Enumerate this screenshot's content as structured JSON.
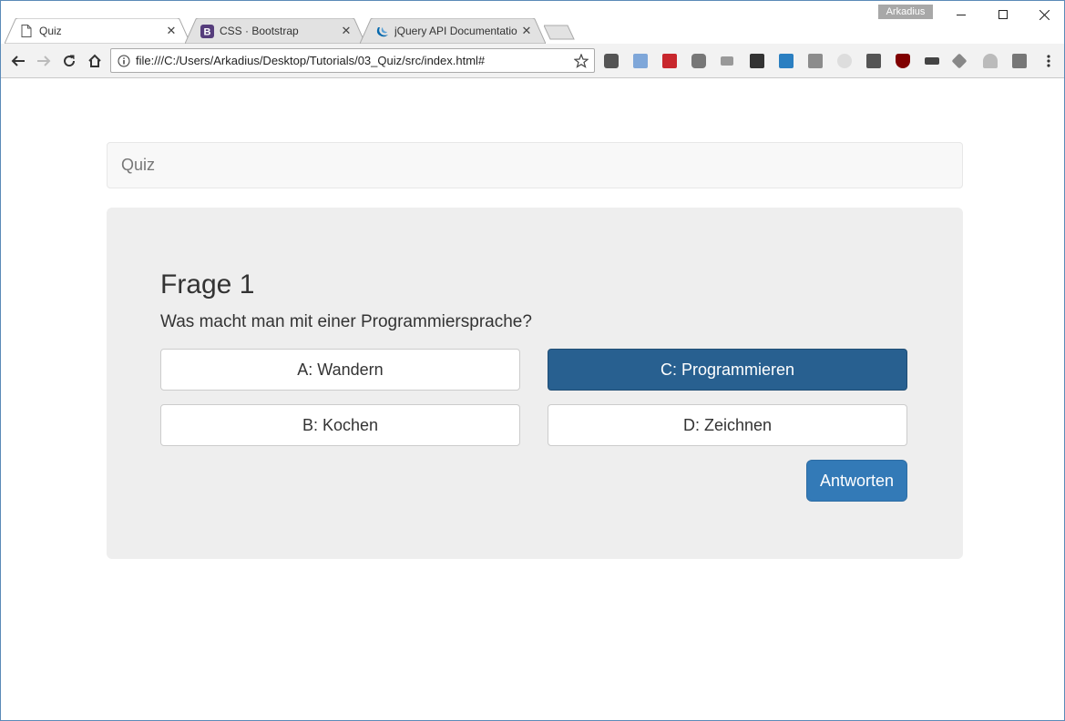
{
  "browser": {
    "tabs": [
      {
        "title": "Quiz",
        "icon": "page-icon",
        "active": true
      },
      {
        "title": "CSS · Bootstrap",
        "icon": "bootstrap-icon",
        "active": false
      },
      {
        "title": "jQuery API Documentatio",
        "icon": "jquery-icon",
        "active": false
      }
    ],
    "profile_name": "Arkadius",
    "url": "file:///C:/Users/Arkadius/Desktop/Tutorials/03_Quiz/src/index.html#",
    "colors": {
      "window_border": "#5b8ab8",
      "toolbar": "#f2f2f2"
    }
  },
  "page": {
    "navbar_brand": "Quiz",
    "question_title": "Frage 1",
    "question_text": "Was macht man mit einer Programmiersprache?",
    "answers": [
      {
        "label": "A: Wandern",
        "selected": false
      },
      {
        "label": "C: Programmieren",
        "selected": true
      },
      {
        "label": "B: Kochen",
        "selected": false
      },
      {
        "label": "D: Zeichnen",
        "selected": false
      }
    ],
    "submit_label": "Antworten",
    "colors": {
      "primary": "#337ab7",
      "selected": "#286090",
      "jumbotron": "#eeeeee"
    }
  }
}
